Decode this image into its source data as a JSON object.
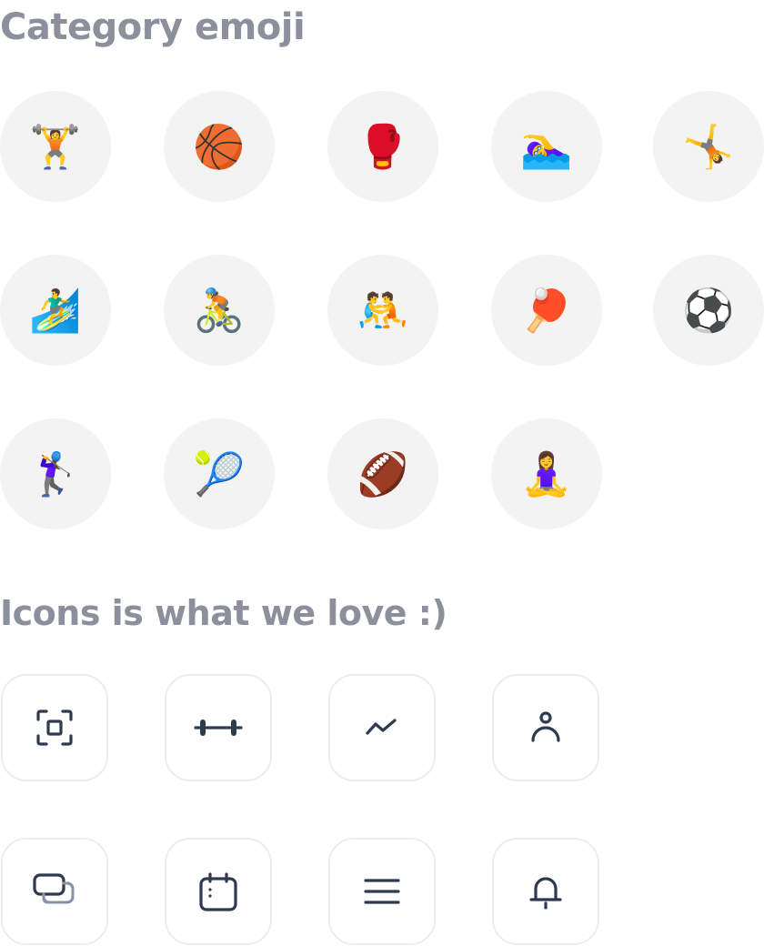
{
  "headings": {
    "categories": "Category emoji",
    "icons": "Icons is what we love :)"
  },
  "categories": [
    {
      "name": "weightlifting",
      "emoji": "🏋️"
    },
    {
      "name": "basketball",
      "emoji": "🏀"
    },
    {
      "name": "boxing",
      "emoji": "🥊"
    },
    {
      "name": "swimming",
      "emoji": "🏊‍♀️"
    },
    {
      "name": "gymnastics",
      "emoji": "🤸"
    },
    {
      "name": "surfing",
      "emoji": "🏄‍♂️"
    },
    {
      "name": "cycling",
      "emoji": "🚴"
    },
    {
      "name": "wrestling",
      "emoji": "🤼"
    },
    {
      "name": "ping-pong",
      "emoji": "🏓"
    },
    {
      "name": "soccer",
      "emoji": "⚽"
    },
    {
      "name": "golf",
      "emoji": "🏌️‍♀️"
    },
    {
      "name": "tennis",
      "emoji": "🎾"
    },
    {
      "name": "american-football",
      "emoji": "🏈"
    },
    {
      "name": "yoga",
      "emoji": "🧘‍♀️"
    }
  ],
  "icons": [
    {
      "name": "scan-icon"
    },
    {
      "name": "dumbbell-icon"
    },
    {
      "name": "trend-icon"
    },
    {
      "name": "user-icon"
    },
    {
      "name": "layers-icon"
    },
    {
      "name": "calendar-icon"
    },
    {
      "name": "menu-icon"
    },
    {
      "name": "bell-icon"
    }
  ],
  "colors": {
    "heading": "#8c909c",
    "circle_bg": "#f3f3f3",
    "icon_border": "#ececee",
    "icon_stroke": "#2e3a4f",
    "icon_secondary": "#8a93a6"
  }
}
